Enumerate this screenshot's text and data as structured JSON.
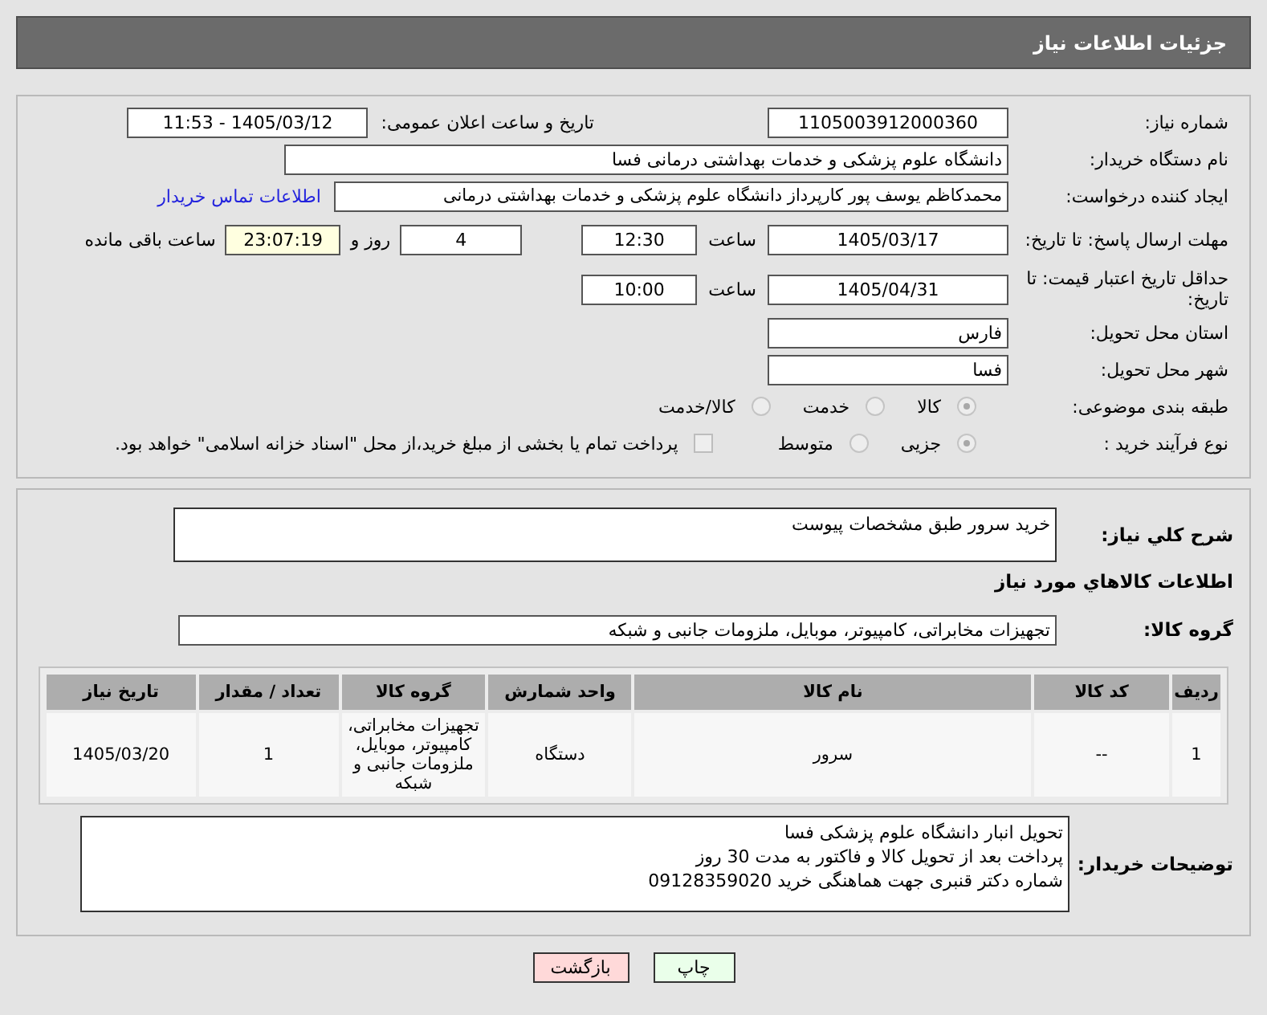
{
  "header": {
    "title": "جزئیات اطلاعات نیاز"
  },
  "need_number": {
    "label": "شماره نیاز:",
    "value": "1105003912000360"
  },
  "announce": {
    "label": "تاریخ و ساعت اعلان عمومی:",
    "value": "1405/03/12 - 11:53"
  },
  "buyer_org": {
    "label": "نام دستگاه خریدار:",
    "value": "دانشگاه علوم پزشکی و خدمات بهداشتی درمانی فسا"
  },
  "requester": {
    "label": "ایجاد کننده درخواست:",
    "value": "محمدکاظم یوسف پور کارپرداز دانشگاه علوم پزشکی و خدمات بهداشتی درمانی",
    "link": "اطلاعات تماس خریدار"
  },
  "deadline": {
    "label": "مهلت ارسال پاسخ: تا تاریخ:",
    "date": "1405/03/17",
    "time_label": "ساعت",
    "time": "12:30",
    "days": "4",
    "days_label": "روز و",
    "remaining": "23:07:19",
    "remaining_label": "ساعت باقی مانده"
  },
  "validity": {
    "label": "حداقل تاریخ اعتبار قیمت: تا تاریخ:",
    "date": "1405/04/31",
    "time_label": "ساعت",
    "time": "10:00"
  },
  "province": {
    "label": "استان محل تحویل:",
    "value": "فارس"
  },
  "city": {
    "label": "شهر محل تحویل:",
    "value": "فسا"
  },
  "category": {
    "label": "طبقه بندی موضوعی:",
    "options": [
      {
        "label": "کالا",
        "selected": true
      },
      {
        "label": "خدمت",
        "selected": false
      },
      {
        "label": "کالا/خدمت",
        "selected": false
      }
    ]
  },
  "process": {
    "label": "نوع فرآیند خرید :",
    "options": [
      {
        "label": "جزیی",
        "selected": true
      },
      {
        "label": "متوسط",
        "selected": false
      }
    ],
    "checkbox": {
      "label": "پرداخت تمام یا بخشی از مبلغ خرید،از محل \"اسناد خزانه اسلامی\" خواهد بود.",
      "checked": false
    }
  },
  "description": {
    "label": "شرح کلي نياز:",
    "value": "خرید سرور طبق مشخصات  پیوست"
  },
  "goods_heading": "اطلاعات کالاهاي مورد نياز",
  "goods_group": {
    "label": "گروه کالا:",
    "value": "تجهیزات مخابراتی، کامپیوتر، موبایل، ملزومات جانبی و شبکه"
  },
  "table": {
    "columns": [
      "ردیف",
      "کد کالا",
      "نام کالا",
      "واحد شمارش",
      "گروه کالا",
      "تعداد / مقدار",
      "تاریخ نیاز"
    ],
    "rows": [
      [
        "1",
        "--",
        "سرور",
        "دستگاه",
        "تجهیزات مخابراتی، کامپیوتر، موبایل، ملزومات جانبی و شبکه",
        "1",
        "1405/03/20"
      ]
    ]
  },
  "buyer_notes": {
    "label": "توضیحات خریدار:",
    "lines": [
      "تحویل انبار دانشگاه علوم پزشکی فسا",
      " پرداخت بعد از تحویل کالا و فاکتور به مدت 30 روز",
      "شماره دکتر قنبری جهت هماهنگی خرید 09128359020"
    ]
  },
  "buttons": [
    {
      "label": "چاپ",
      "kind": "print"
    },
    {
      "label": "بازگشت",
      "kind": "back"
    }
  ]
}
